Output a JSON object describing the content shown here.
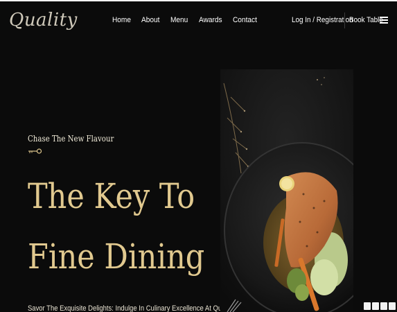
{
  "header": {
    "logo": "Quality",
    "nav": [
      "Home",
      "About",
      "Menu",
      "Awards",
      "Contact"
    ],
    "auth_label": "Log In / Registration",
    "book_label": "Book Table"
  },
  "hero": {
    "tagline": "Chase The New Flavour",
    "headline_line1": "The Key To",
    "headline_line2": "Fine Dining",
    "subtext": "Savor The Exquisite Delights: Indulge In Culinary Excellence At Quality"
  },
  "colors": {
    "background": "#0b0b0b",
    "accent": "#e1c98f",
    "text": "#ffffff"
  }
}
